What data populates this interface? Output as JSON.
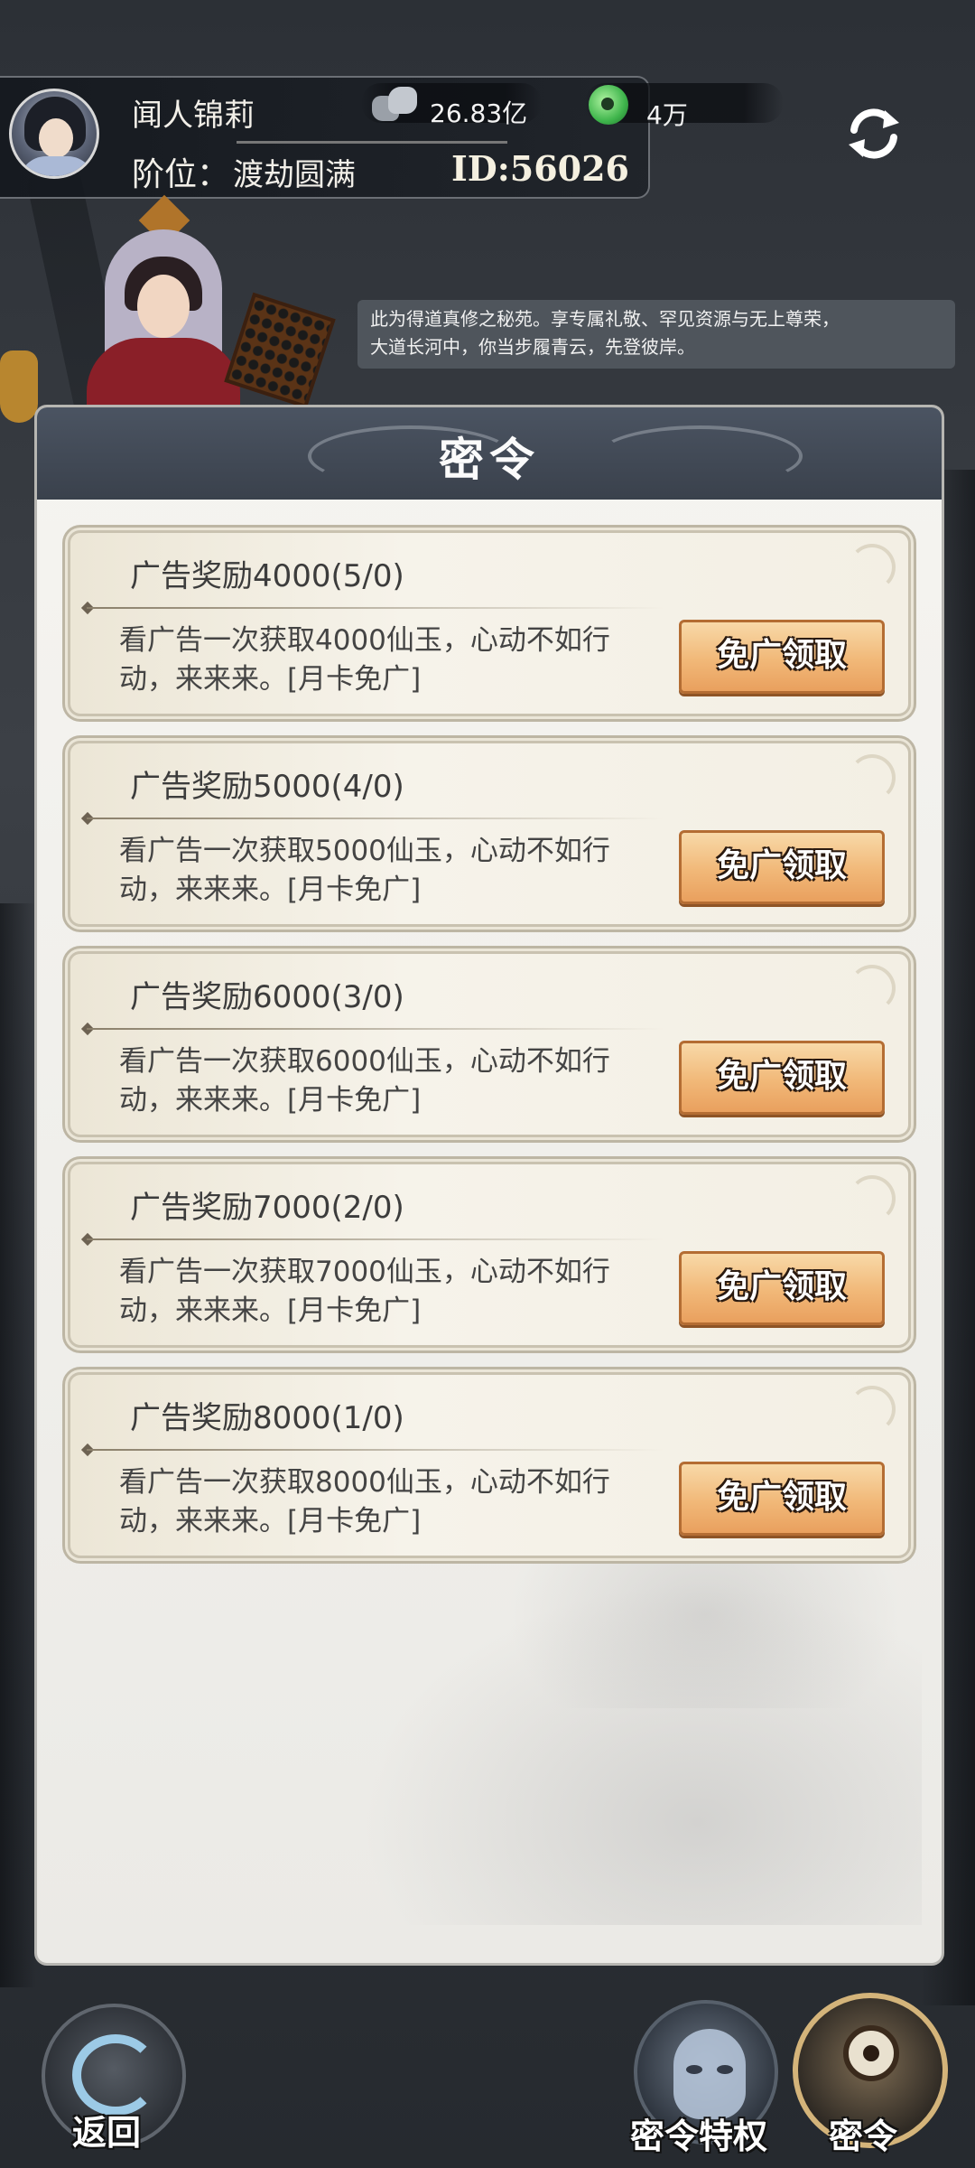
{
  "player": {
    "name": "闻人锦莉",
    "rank_label": "阶位：",
    "rank_value": "渡劫圆满",
    "id_text": "ID:56026",
    "stone_amount": "26.83亿",
    "jade_amount": "4万"
  },
  "dialogue": {
    "line1": "此为得道真修之秘苑。享专属礼敬、罕见资源与无上尊荣，",
    "line2": "大道长河中，你当步履青云，先登彼岸。"
  },
  "panel": {
    "title": "密令",
    "items": [
      {
        "title": "广告奖励4000(5/0)",
        "desc": "看广告一次获取4000仙玉，心动不如行动，来来来。[月卡免广]",
        "button": "免广领取"
      },
      {
        "title": "广告奖励5000(4/0)",
        "desc": "看广告一次获取5000仙玉，心动不如行动，来来来。[月卡免广]",
        "button": "免广领取"
      },
      {
        "title": "广告奖励6000(3/0)",
        "desc": "看广告一次获取6000仙玉，心动不如行动，来来来。[月卡免广]",
        "button": "免广领取"
      },
      {
        "title": "广告奖励7000(2/0)",
        "desc": "看广告一次获取7000仙玉，心动不如行动，来来来。[月卡免广]",
        "button": "免广领取"
      },
      {
        "title": "广告奖励8000(1/0)",
        "desc": "看广告一次获取8000仙玉，心动不如行动，来来来。[月卡免广]",
        "button": "免广领取"
      }
    ]
  },
  "nav": {
    "back": "返回",
    "privilege": "密令特权",
    "command": "密令"
  },
  "icons": {
    "refresh": "refresh-icon",
    "stone": "spirit-stone-icon",
    "jade": "jade-icon"
  }
}
